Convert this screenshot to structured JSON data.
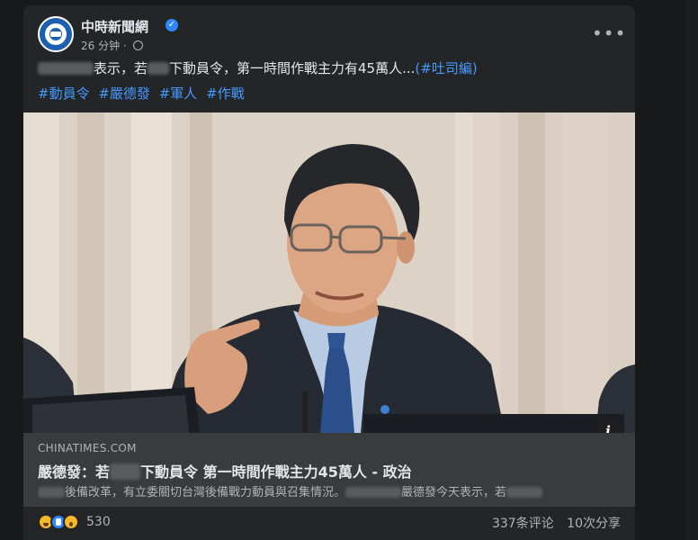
{
  "post": {
    "page_name": "中時新聞網",
    "time": "26 分钟",
    "separator": "·",
    "caption_after_redact1": "表示，若",
    "caption_after_redact2": "下動員令，第一時間作戰主力有45萬人...",
    "caption_link": "(#吐司編)",
    "hashtags": [
      "#動員令",
      "#嚴德發",
      "#軍人",
      "#作戰"
    ]
  },
  "link_preview": {
    "domain": "CHINATIMES.COM",
    "title_before": "嚴德發：若",
    "title_after": "下動員令 第一時間作戰主力45萬人 - 政治",
    "desc_part1": "後備改革，有立委關切台灣後備戰力動員與召集情況。",
    "desc_part2": "嚴德發今天表示，若"
  },
  "footer": {
    "reaction_count": "530",
    "comments": "337条评论",
    "shares": "10次分享"
  },
  "icons": [
    "verified-icon",
    "globe-icon",
    "more-icon",
    "info-icon",
    "haha-reaction-icon",
    "like-reaction-icon",
    "wow-reaction-icon"
  ],
  "colors": {
    "card_bg": "#242526",
    "page_bg": "#18191a",
    "link_blue": "#4599ff",
    "preview_bg": "#3a3b3c"
  }
}
